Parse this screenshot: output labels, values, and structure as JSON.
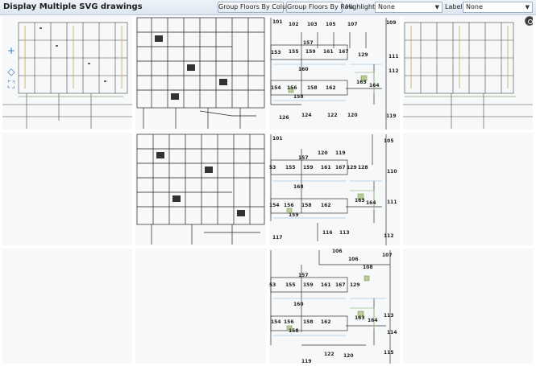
{
  "window": {
    "title": "Display Multiple SVG drawings"
  },
  "toolbar": {
    "group_by_column": "Group Floors By Column",
    "group_by_row": "Group Floors By Row",
    "highlights_label": "Highlights:",
    "highlights_value": "None",
    "labels_label": "Labels:",
    "labels_value": "None"
  },
  "controls": {
    "zoom_in": "+",
    "pan": "◇",
    "fit": "⛶"
  },
  "rooms": {
    "r101": "101",
    "r102": "102",
    "r103": "103",
    "r105": "105",
    "r107": "107",
    "r109": "109",
    "r111": "111",
    "r112": "112",
    "r113": "113",
    "r114": "114",
    "r115": "115",
    "r116": "116",
    "r117": "117",
    "r119": "119",
    "r120": "120",
    "r122": "122",
    "r124": "124",
    "r126": "126",
    "r128": "128",
    "r129": "129",
    "r153": "153",
    "r154": "154",
    "r155": "155",
    "r156": "156",
    "r157": "157",
    "r158": "158",
    "r159": "159",
    "r160": "160",
    "r161": "161",
    "r162": "162",
    "r163": "163",
    "r164": "164",
    "r167": "167",
    "r168": "168",
    "r106": "106",
    "r108": "108",
    "r110": "110",
    "r53": "53"
  },
  "colors": {
    "toolbar_top": "#eef3f9",
    "panel_bg": "#f6f8fa",
    "wall": "#2a2a2a",
    "green_highlight": "#a8c08a",
    "blue_accent": "#3b76b8"
  }
}
